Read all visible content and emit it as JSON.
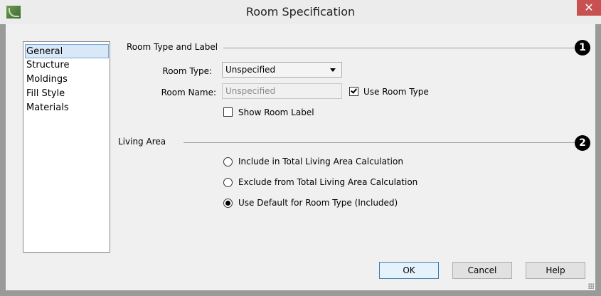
{
  "window": {
    "title": "Room Specification",
    "close_glyph": "✕",
    "app_icon": "app-logo-icon"
  },
  "sidebar": {
    "selected": "General",
    "items": [
      {
        "label": "General"
      },
      {
        "label": "Structure"
      },
      {
        "label": "Moldings"
      },
      {
        "label": "Fill Style"
      },
      {
        "label": "Materials"
      }
    ]
  },
  "room_type_group": {
    "title": "Room Type and Label",
    "badge": "1",
    "room_type_label": "Room Type:",
    "room_type_value": "Unspecified",
    "room_name_label": "Room Name:",
    "room_name_value": "Unspecified",
    "use_room_type_label": "Use Room Type",
    "use_room_type_checked": true,
    "show_room_label_label": "Show Room Label",
    "show_room_label_checked": false
  },
  "living_area_group": {
    "title": "Living Area",
    "badge": "2",
    "options": [
      {
        "label": "Include in Total Living Area Calculation",
        "selected": false
      },
      {
        "label": "Exclude from Total Living Area Calculation",
        "selected": false
      },
      {
        "label": "Use Default for Room Type (Included)",
        "selected": true
      }
    ]
  },
  "buttons": {
    "ok": "OK",
    "cancel": "Cancel",
    "help": "Help"
  },
  "colors": {
    "close_button": "#c75050",
    "selection_highlight": "#d9e8f7",
    "dialog_background": "#f0f0f0"
  }
}
